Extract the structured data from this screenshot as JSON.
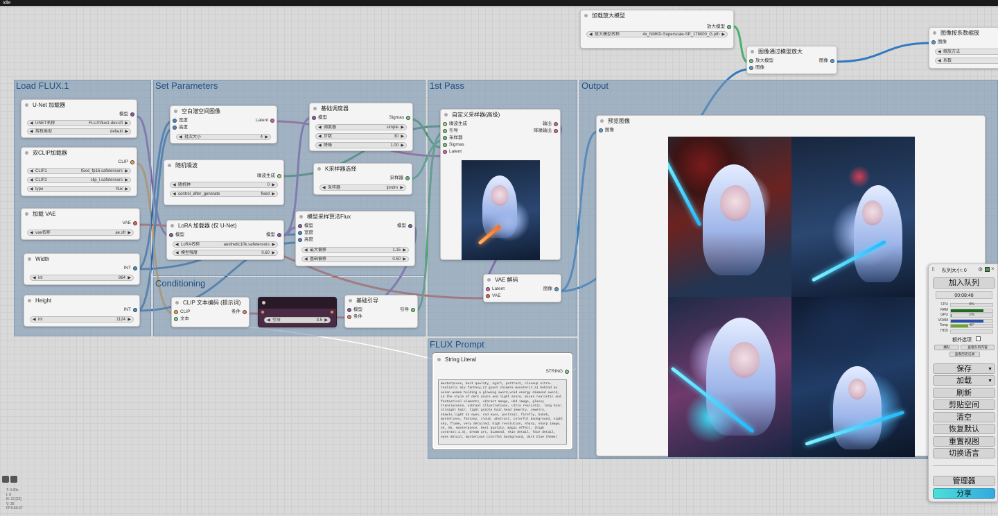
{
  "titlebar": {
    "text": "Idle"
  },
  "groups": {
    "load": "Load FLUX.1",
    "set": "Set Parameters",
    "pass": "1st Pass",
    "output": "Output",
    "cond": "Conditioning",
    "prompt": "FLUX Prompt"
  },
  "nodes": {
    "unet": {
      "title": "U-Net 加载器",
      "out": "模型",
      "w1_label": "UNET名称",
      "w1_value": "FLUX\\flux1-dev.sft",
      "w2_label": "剪枝类型",
      "w2_value": "default"
    },
    "dualclip": {
      "title": "双CLIP加载器",
      "out": "CLIP",
      "w1_label": "CLIP1",
      "w1_value": "t5xxl_fp16.safetensors",
      "w2_label": "CLIP2",
      "w2_value": "clip_l.safetensors",
      "w3_label": "type",
      "w3_value": "flux"
    },
    "vae": {
      "title": "加载 VAE",
      "out": "VAE",
      "w1_label": "vae名称",
      "w1_value": "ae.sft"
    },
    "width": {
      "title": "Width",
      "out": "INT",
      "w1_label": "int",
      "w1_value": "864"
    },
    "height": {
      "title": "Height",
      "out": "INT",
      "w1_label": "int",
      "w1_value": "1124"
    },
    "latent": {
      "title": "空白潜空间图像",
      "in1": "宽度",
      "in2": "高度",
      "out": "Latent",
      "w1_label": "批次大小",
      "w1_value": "4"
    },
    "noise": {
      "title": "随机噪波",
      "out": "噪波生成",
      "w1_label": "随机种",
      "w1_value": "0",
      "w2_label": "control_after_generate",
      "w2_value": "fixed"
    },
    "lora": {
      "title": "LoRA 加载器 (仅 U-Net)",
      "in1": "模型",
      "out": "模型",
      "w1_label": "LoRA名称",
      "w1_value": "aesthetic10k.safetensors",
      "w2_label": "模型强度",
      "w2_value": "0.60"
    },
    "scheduler": {
      "title": "基础调度器",
      "in1": "模型",
      "out": "Sigmas",
      "w1_label": "调度器",
      "w1_value": "simple",
      "w2_label": "步数",
      "w2_value": "30",
      "w3_label": "降噪",
      "w3_value": "1.00"
    },
    "ksel": {
      "title": "K采样器选择",
      "out": "采样器",
      "w1_label": "采样器",
      "w1_value": "ipndm"
    },
    "msflux": {
      "title": "模型采样算法Flux",
      "in1": "模型",
      "in2": "宽度",
      "in3": "高度",
      "out": "模型",
      "w1_label": "最大偏移",
      "w1_value": "1.15",
      "w2_label": "基础偏移",
      "w2_value": "0.50"
    },
    "sampler": {
      "title": "自定义采样器(高级)",
      "in1": "噪波生成",
      "in2": "引导",
      "in3": "采样器",
      "in4": "Sigmas",
      "in5": "Latent",
      "out1": "输出",
      "out2": "降噪输出"
    },
    "vaedec": {
      "title": "VAE 解码",
      "in1": "Latent",
      "in2": "VAE",
      "out": "图像"
    },
    "clipenc": {
      "title": "CLIP 文本编码 (提示词)",
      "in1": "CLIP",
      "in2": "文本",
      "out": "条件"
    },
    "guid": {
      "w1_label": "引导",
      "w1_value": "3.5"
    },
    "basicguide": {
      "title": "基础引导",
      "in1": "模型",
      "in2": "条件",
      "out": "引导"
    },
    "strlit": {
      "title": "String Literal",
      "out": "STRING",
      "text": "masterpiece, best quality, 1girl, portrait, closeup ultra-realistic mix fantasy,(2 giant chimera monster(1.3) behind an asian woman holding a glowing sword,void energy diamond sword, in the style of dark azure and light azure, mixes realistic and fantastical elements, vibrant manga, uhd image, glassy translucence, vibrant illustrations, ultra realistic, long hair, straight hair, light purple hair,head jewelry, jewelry, shawls,light In eyes, red eyes, portrait, firefly, bokeh, mysterious, fantasy, cloud, abstract, colorful background, night sky, flame, very detailed, high resolution, sharp, sharp image, 4k, 8k, masterpiece, best quality, magic effect, (high contrast:1.4), dream art, diamond, skin detail, face detail, eyes detail, mysterious colorful background, dark blue theme)"
    },
    "preview": {
      "title": "预览图像",
      "in1": "图像"
    },
    "upload": {
      "title": "加载放大模型",
      "out": "放大模型",
      "w1_label": "放大模型名称",
      "w1_value": "4x_NMKD-Superscale-SP_178000_G.pth"
    },
    "upscale": {
      "title": "图像通过模型放大",
      "in1": "放大模型",
      "in2": "图像",
      "out": "图像"
    },
    "scaleby": {
      "title": "图像按系数缩放",
      "in1": "图像",
      "w1_label": "缩放方法",
      "w2_label": "系数"
    }
  },
  "panel": {
    "queue_size": "队列大小: 0",
    "add_queue": "加入队列",
    "timer": "00:08:48",
    "stats": [
      {
        "label": "CPU",
        "value": "0%",
        "fill": 0,
        "color": "#3a8a3a"
      },
      {
        "label": "RAM",
        "value": "",
        "fill": 0.78,
        "color": "#1e6b1e"
      },
      {
        "label": "GPU",
        "value": "1%",
        "fill": 0.01,
        "color": "#3a8a3a"
      },
      {
        "label": "VRAM",
        "value": "",
        "fill": 0.78,
        "color": "#2a4fa8"
      },
      {
        "label": "Temp",
        "value": "42°",
        "fill": 0.42,
        "color": "#6aa82a"
      },
      {
        "label": "HDD",
        "value": "",
        "fill": 0,
        "color": "#888888"
      }
    ],
    "extra_options": "额外选项",
    "small1": "播队",
    "small2": "查看队列内容",
    "small3": "查看历史记录",
    "save": "保存",
    "load": "加载",
    "refresh": "刷新",
    "clipspace": "剪贴空间",
    "clear": "清空",
    "restore": "恢复默认",
    "reset_view": "重置视图",
    "switch_lang": "切换语言",
    "manager": "管理器",
    "share": "分享"
  },
  "canvas_stats": [
    "T: 0.00s",
    "I: 0",
    "N: 22 [22]",
    "V: 36",
    "FPS:56.67"
  ]
}
